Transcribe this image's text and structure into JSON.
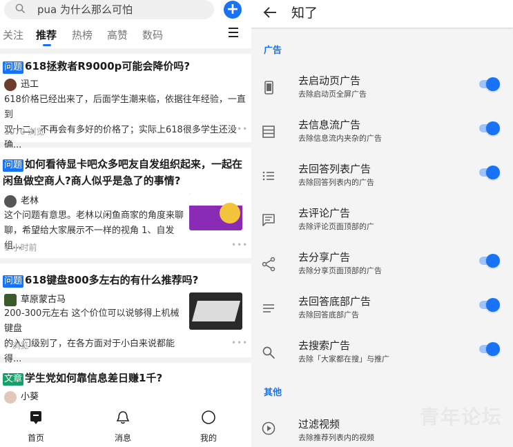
{
  "left": {
    "search": {
      "query": "pua 为什么那么可怕",
      "icon": "search-icon"
    },
    "tabs": [
      {
        "label": "关注"
      },
      {
        "label": "推荐"
      },
      {
        "label": "热榜"
      },
      {
        "label": "高赞"
      },
      {
        "label": "数码"
      }
    ],
    "feed": [
      {
        "tag": "问题",
        "title": "618拯救者R9000p可能会降价吗?",
        "author": "迅工",
        "excerpt_line1": "618价格已经出来了，后面学生潮来临，依据往年经验，一直到",
        "excerpt_line2": "双十二，不再会有多好的价格了；实际上618很多学生还没确...",
        "meta": "1070 浏览"
      },
      {
        "tag": "问题",
        "title_line1": "如何看待显卡吧众多吧友自发组织起来，一起在",
        "title_line2": "闲鱼做空商人?商人似乎是急了的事情?",
        "author": "老林",
        "excerpt_line1": "这个问题有意思。老林以闲鱼商家的角度来聊",
        "excerpt_line2": "聊，希望给大家展示不一样的视角 1、自发组...",
        "meta": "1 小时前"
      },
      {
        "tag": "问题",
        "title": "618键盘800多左右的有什么推荐吗?",
        "author": "草原蒙古马",
        "excerpt_line1": "200-300元左右 这个价位可以说够得上机械键盘",
        "excerpt_line2": "的入门级别了，在各方面对于小白来说都能得...",
        "meta": "7 浏览"
      },
      {
        "tag": "文章",
        "title": "学生党如何靠信息差日赚1千?",
        "author": "小葵"
      }
    ],
    "nav": [
      {
        "label": "首页",
        "icon": "home-icon"
      },
      {
        "label": "消息",
        "icon": "bell-icon"
      },
      {
        "label": "我的",
        "icon": "profile-icon"
      }
    ],
    "accent": "#1772f6"
  },
  "right": {
    "title": "知了",
    "section_ads": "广告",
    "section_other": "其他",
    "rows": [
      {
        "title": "去启动页广告",
        "subtitle": "去除启动页全屏广告",
        "icon": "phone-icon",
        "on": true
      },
      {
        "title": "去信息流广告",
        "subtitle": "去除信息流内夹杂的广告",
        "icon": "feed-icon",
        "on": true
      },
      {
        "title": "去回答列表广告",
        "subtitle": "去除回答列表内的广告",
        "icon": "list-icon",
        "on": true
      },
      {
        "title": "去评论广告",
        "subtitle": "去除评论页面顶部的广",
        "icon": "comment-icon",
        "on": false
      },
      {
        "title": "去分享广告",
        "subtitle": "去除分享页面顶部的广告",
        "icon": "share-icon",
        "on": true
      },
      {
        "title": "去回答底部广告",
        "subtitle": "去除回答底部广告",
        "icon": "lines-icon",
        "on": true
      },
      {
        "title": "去搜索广告",
        "subtitle": "去除「大家都在搜」与推广",
        "icon": "search-icon",
        "on": true
      }
    ],
    "other_rows": [
      {
        "title": "过滤视频",
        "subtitle": "去除推荐列表内的视频",
        "icon": "play-icon"
      }
    ],
    "watermark": "青年论坛",
    "accent": "#1772f6"
  }
}
